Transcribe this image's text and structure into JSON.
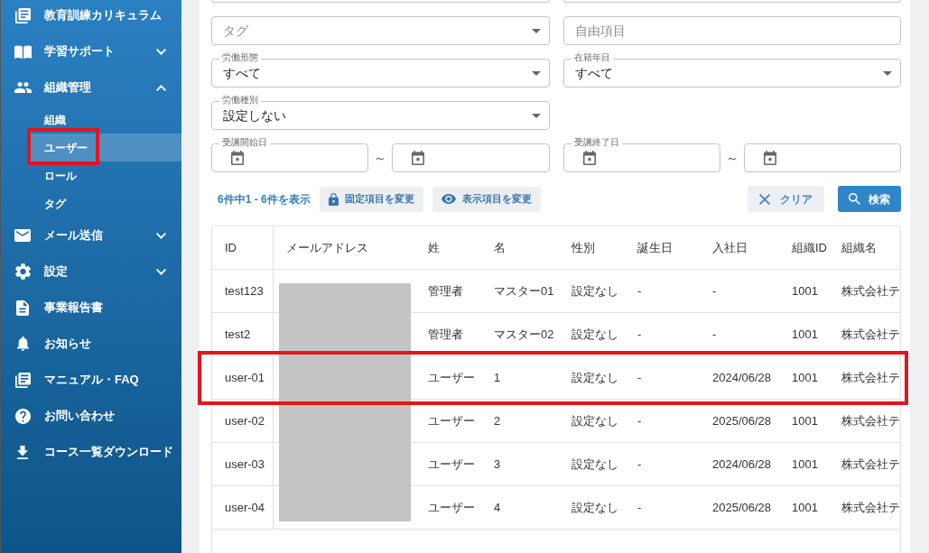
{
  "sidebar": {
    "items": [
      {
        "label": "教育訓練カリキュラム"
      },
      {
        "label": "学習サポート",
        "expanded": false
      },
      {
        "label": "組織管理",
        "expanded": true,
        "children": [
          {
            "label": "組織",
            "selected": false,
            "annotated": false
          },
          {
            "label": "ユーザー",
            "selected": true,
            "annotated": true
          },
          {
            "label": "ロール",
            "selected": false,
            "annotated": false
          },
          {
            "label": "タグ",
            "selected": false,
            "annotated": false
          }
        ]
      },
      {
        "label": "メール送信",
        "expanded": false
      },
      {
        "label": "設定",
        "expanded": false
      },
      {
        "label": "事業報告書"
      },
      {
        "label": "お知らせ"
      },
      {
        "label": "マニュアル・FAQ"
      },
      {
        "label": "お問い合わせ"
      },
      {
        "label": "コース一覧ダウンロード"
      }
    ]
  },
  "filters": [
    [
      {
        "kind": "clipped"
      },
      {
        "kind": "clipped"
      }
    ],
    [
      {
        "kind": "select",
        "placeholder": "タグ"
      },
      {
        "kind": "text",
        "placeholder": "自由項目"
      }
    ],
    [
      {
        "kind": "select",
        "label": "労働形態",
        "value": "すべて"
      },
      {
        "kind": "select",
        "label": "在籍年目",
        "value": "すべて"
      }
    ],
    [
      {
        "kind": "select",
        "label": "労働種別",
        "value": "設定しない"
      }
    ],
    [
      {
        "kind": "date_range",
        "label": "受講開始日",
        "separator": "～"
      },
      {
        "kind": "date_range",
        "label": "受講終了日",
        "separator": "～"
      }
    ]
  ],
  "results": {
    "summary": "6件中1 - 6件を表示",
    "buttons": [
      {
        "label": "固定項目を変更"
      },
      {
        "label": "表示項目を変更"
      }
    ]
  },
  "actions": [
    {
      "label": "クリア",
      "kind": "secondary"
    },
    {
      "label": "検索",
      "kind": "primary"
    }
  ],
  "table": {
    "columns": [
      {
        "label": "ID",
        "redacted": false
      },
      {
        "label": "メールアドレス",
        "redacted": true
      },
      {
        "label": "姓",
        "redacted": false
      },
      {
        "label": "名",
        "redacted": false
      },
      {
        "label": "性別",
        "redacted": false
      },
      {
        "label": "誕生日",
        "redacted": false
      },
      {
        "label": "入社日",
        "redacted": false
      },
      {
        "label": "組織ID",
        "redacted": false
      },
      {
        "label": "組織名",
        "redacted": false
      }
    ],
    "rows": [
      {
        "cells": [
          "test123",
          "",
          "管理者",
          "マスター01",
          "設定なし",
          "-",
          "-",
          "1001",
          "株式会社テ"
        ],
        "annotated": false
      },
      {
        "cells": [
          "test2",
          "",
          "管理者",
          "マスター02",
          "設定なし",
          "-",
          "-",
          "1001",
          "株式会社テ"
        ],
        "annotated": false
      },
      {
        "cells": [
          "user-01",
          "",
          "ユーザー",
          "1",
          "設定なし",
          "-",
          "2024/06/28",
          "1001",
          "株式会社テ"
        ],
        "annotated": true
      },
      {
        "cells": [
          "user-02",
          "",
          "ユーザー",
          "2",
          "設定なし",
          "-",
          "2025/06/28",
          "1001",
          "株式会社テ"
        ],
        "annotated": false
      },
      {
        "cells": [
          "user-03",
          "",
          "ユーザー",
          "3",
          "設定なし",
          "-",
          "2024/06/28",
          "1001",
          "株式会社テ"
        ],
        "annotated": false
      },
      {
        "cells": [
          "user-04",
          "",
          "ユーザー",
          "4",
          "設定なし",
          "-",
          "2025/06/28",
          "1001",
          "株式会社テ"
        ],
        "annotated": false
      }
    ]
  }
}
